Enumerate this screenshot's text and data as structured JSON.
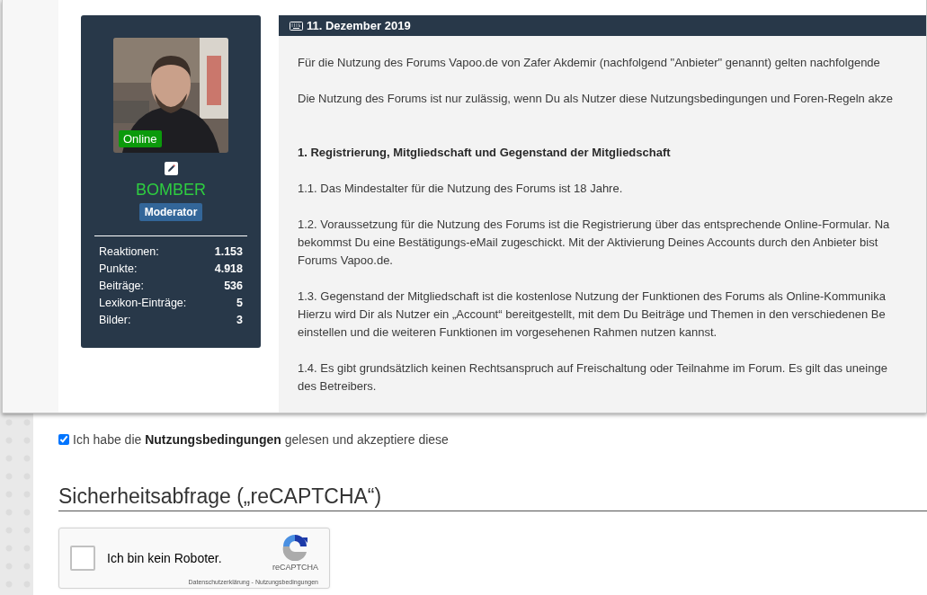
{
  "profile": {
    "status": "Online",
    "username": "BOMBER",
    "rank": "Moderator",
    "stats": [
      {
        "label": "Reaktionen:",
        "value": "1.153"
      },
      {
        "label": "Punkte:",
        "value": "4.918"
      },
      {
        "label": "Beiträge:",
        "value": "536"
      },
      {
        "label": "Lexikon-Einträge:",
        "value": "5"
      },
      {
        "label": "Bilder:",
        "value": "3"
      }
    ]
  },
  "post": {
    "date": "11. Dezember 2019",
    "paragraphs": [
      {
        "kind": "text",
        "lines": [
          "Für die Nutzung des Forums Vapoo.de von Zafer Akdemir (nachfolgend \"Anbieter\" genannt) gelten nachfolgende"
        ]
      },
      {
        "kind": "text",
        "lines": [
          "Die Nutzung des Forums ist nur zulässig, wenn Du als Nutzer diese Nutzungsbedingungen und Foren-Regeln akze"
        ]
      },
      {
        "kind": "heading",
        "lines": [
          "1. Registrierung, Mitgliedschaft und Gegenstand der Mitgliedschaft"
        ]
      },
      {
        "kind": "text",
        "lines": [
          "1.1. Das Mindestalter für die Nutzung des Forums ist 18 Jahre."
        ]
      },
      {
        "kind": "text",
        "lines": [
          "1.2. Voraussetzung für die Nutzung des Forums ist die Registrierung über das entsprechende Online-Formular. Na",
          "bekommst Du eine Bestätigungs-eMail zugeschickt. Mit der Aktivierung Deines Accounts durch den Anbieter bist",
          "Forums Vapoo.de."
        ]
      },
      {
        "kind": "text",
        "lines": [
          "1.3. Gegenstand der Mitgliedschaft ist die kostenlose Nutzung der Funktionen des Forums als Online-Kommunika",
          "Hierzu wird Dir als Nutzer ein „Account“ bereitgestellt, mit dem Du Beiträge und Themen in den verschiedenen Be",
          "einstellen und die weiteren Funktionen im vorgesehenen Rahmen nutzen kannst."
        ]
      },
      {
        "kind": "text",
        "lines": [
          "1.4. Es gibt grundsätzlich keinen Rechtsanspruch auf Freischaltung oder Teilnahme im Forum. Es gilt das uneinge",
          "des Betreibers."
        ]
      }
    ]
  },
  "terms_checkbox": {
    "checked": true,
    "label": "Ich habe die **Nutzungsbedingungen** gelesen und akzeptiere diese"
  },
  "captcha_section": {
    "heading": "Sicherheitsabfrage („reCAPTCHA“)",
    "checked": false,
    "label": "Ich bin kein Roboter.",
    "brand": "reCAPTCHA",
    "links": [
      "Datenschutzerklärung",
      "Nutzungsbedingungen"
    ],
    "separator": "-"
  }
}
